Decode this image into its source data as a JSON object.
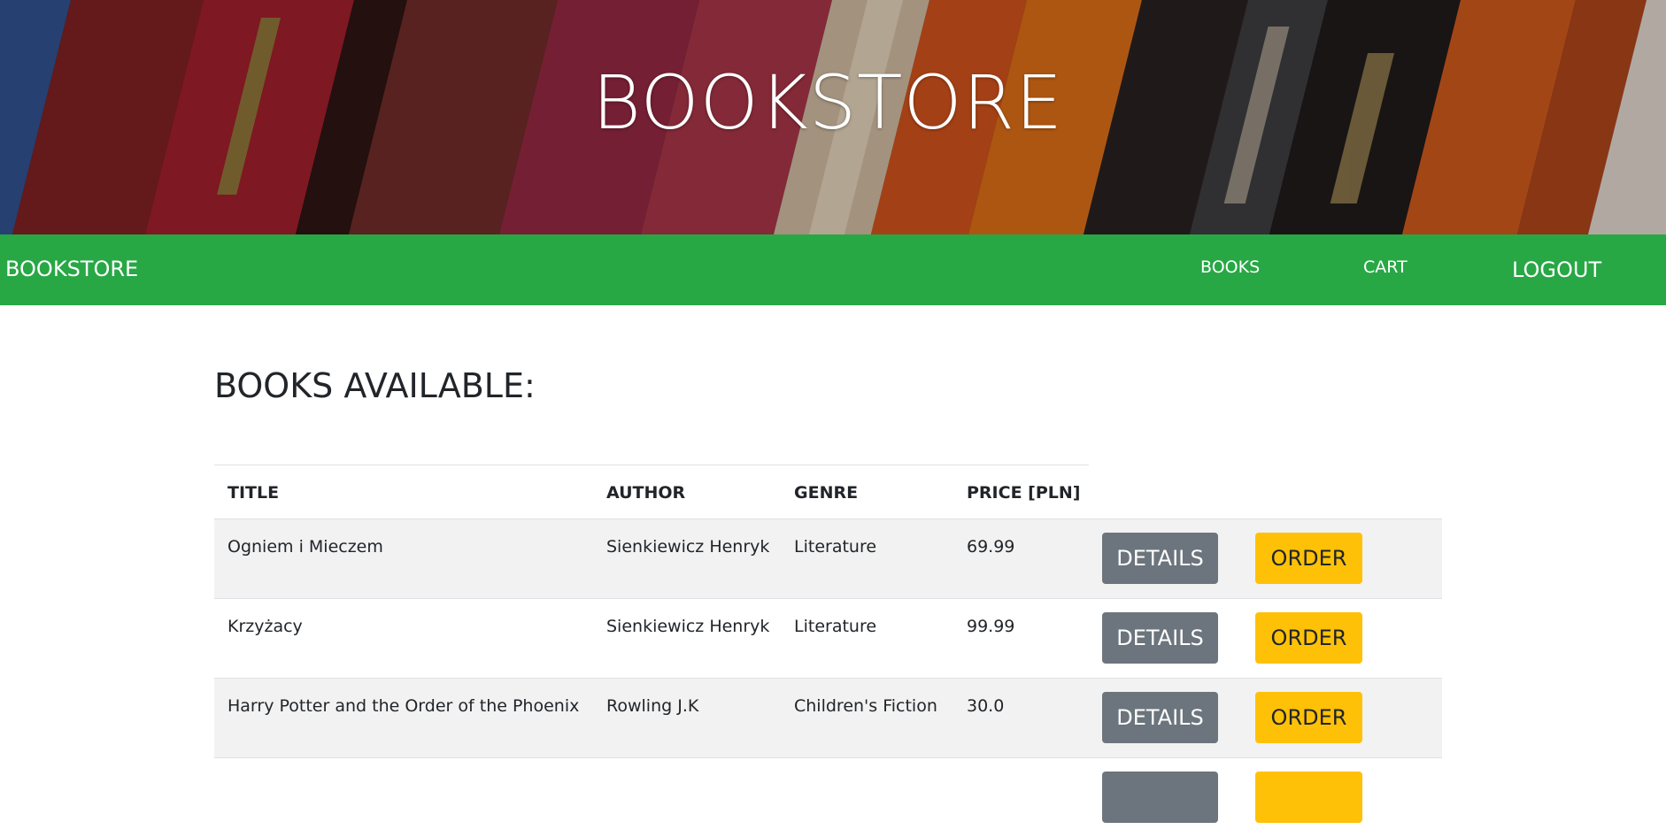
{
  "hero": {
    "title": "BOOKSTORE"
  },
  "navbar": {
    "brand": "BOOKSTORE",
    "links": {
      "books": "BOOKS",
      "cart": "CART",
      "logout": "LOGOUT"
    },
    "color": "#28a745"
  },
  "main": {
    "heading": "BOOKS AVAILABLE:",
    "table": {
      "headers": {
        "title": "TITLE",
        "author": "AUTHOR",
        "genre": "GENRE",
        "price": "PRICE [PLN]"
      },
      "rows": [
        {
          "title": "Ogniem i Mieczem",
          "author": "Sienkiewicz Henryk",
          "genre": "Literature",
          "price": "69.99",
          "details_label": "DETAILS",
          "order_label": "ORDER"
        },
        {
          "title": "Krzyżacy",
          "author": "Sienkiewicz Henryk",
          "genre": "Literature",
          "price": "99.99",
          "details_label": "DETAILS",
          "order_label": "ORDER"
        },
        {
          "title": "Harry Potter and the Order of the Phoenix",
          "author": "Rowling J.K",
          "genre": "Children's Fiction",
          "price": "30.0",
          "details_label": "DETAILS",
          "order_label": "ORDER"
        }
      ]
    }
  },
  "colors": {
    "details_button": "#6c757d",
    "order_button": "#ffc107",
    "striped_row": "#f2f2f2"
  }
}
